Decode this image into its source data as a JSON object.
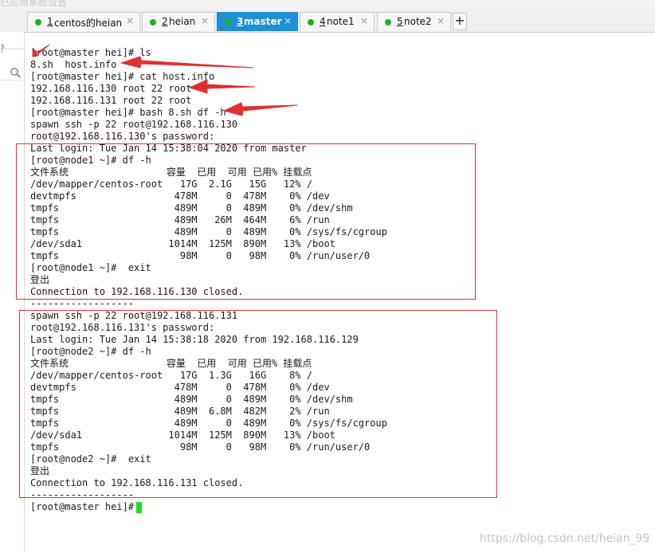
{
  "window": {
    "title_strip": "已应用系统设置"
  },
  "tabs": [
    {
      "number": "1",
      "label": "centos的heian",
      "active": false
    },
    {
      "number": "2",
      "label": "heian",
      "active": false
    },
    {
      "number": "3",
      "label": "master",
      "active": true
    },
    {
      "number": "4",
      "label": "note1",
      "active": false
    },
    {
      "number": "5",
      "label": "note2",
      "active": false
    }
  ],
  "tab_close_glyph": "×",
  "new_tab_glyph": "+",
  "side_panel": {
    "pin_glyph": "ᚹ",
    "search_icon": "search-icon"
  },
  "terminal": {
    "lines": [
      "[root@master hei]# ls",
      "8.sh  host.info",
      "[root@master hei]# cat host.info",
      "192.168.116.130 root 22 root",
      "192.168.116.131 root 22 root",
      "[root@master hei]# bash 8.sh df -h",
      "spawn ssh -p 22 root@192.168.116.130",
      "root@192.168.116.130's password:",
      "Last login: Tue Jan 14 15:38:04 2020 from master",
      "[root@node1 ~]# df -h",
      "文件系统                 容量  已用  可用 已用% 挂载点",
      "/dev/mapper/centos-root   17G  2.1G   15G   12% /",
      "devtmpfs                 478M     0  478M    0% /dev",
      "tmpfs                    489M     0  489M    0% /dev/shm",
      "tmpfs                    489M   26M  464M    6% /run",
      "tmpfs                    489M     0  489M    0% /sys/fs/cgroup",
      "/dev/sda1               1014M  125M  890M   13% /boot",
      "tmpfs                     98M     0   98M    0% /run/user/0",
      "[root@node1 ~]#  exit",
      "登出",
      "Connection to 192.168.116.130 closed.",
      "------------------",
      "spawn ssh -p 22 root@192.168.116.131",
      "root@192.168.116.131's password:",
      "Last login: Tue Jan 14 15:38:18 2020 from 192.168.116.129",
      "[root@node2 ~]# df -h",
      "文件系统                 容量  已用  可用 已用% 挂载点",
      "/dev/mapper/centos-root   17G  1.3G   16G    8% /",
      "devtmpfs                 478M     0  478M    0% /dev",
      "tmpfs                    489M     0  489M    0% /dev/shm",
      "tmpfs                    489M  6.8M  482M    2% /run",
      "tmpfs                    489M     0  489M    0% /sys/fs/cgroup",
      "/dev/sda1               1014M  125M  890M   13% /boot",
      "tmpfs                     98M     0   98M    0% /run/user/0",
      "[root@node2 ~]#  exit",
      "登出",
      "Connection to 192.168.116.131 closed.",
      "------------------",
      "[root@master hei]# "
    ]
  },
  "annotation_color": "#e03030",
  "cursor_color": "#18e018",
  "watermark": "https://blog.csdn.net/heian_99"
}
